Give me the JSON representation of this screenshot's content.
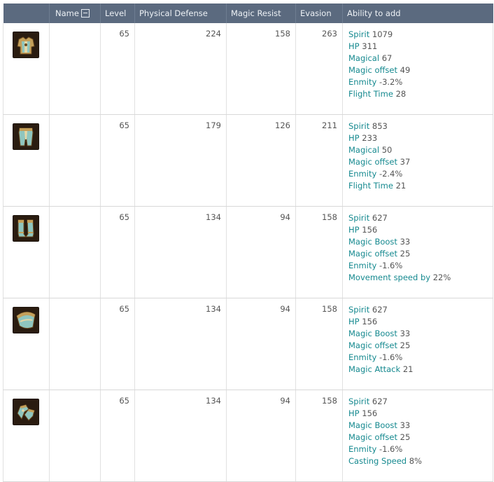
{
  "header": {
    "name": "Name",
    "level": "Level",
    "physical_defense": "Physical Defense",
    "magic_resist": "Magic Resist",
    "evasion": "Evasion",
    "ability": "Ability to add"
  },
  "colors": {
    "header_bg": "#5b6a7f",
    "ability_label": "#15898f",
    "gold_trim": "#c4a05a",
    "cloth_teal": "#8fc6bf"
  },
  "rows": [
    {
      "icon": "chest-armor-icon",
      "level": "65",
      "physical_defense": "224",
      "magic_resist": "158",
      "evasion": "263",
      "abilities": [
        {
          "label": "Spirit",
          "value": "1079"
        },
        {
          "label": "HP",
          "value": "311"
        },
        {
          "label": "Magical",
          "value": "67"
        },
        {
          "label": "Magic offset",
          "value": "49"
        },
        {
          "label": "Enmity",
          "value": "-3.2%"
        },
        {
          "label": "Flight Time",
          "value": "28"
        }
      ]
    },
    {
      "icon": "leg-armor-icon",
      "level": "65",
      "physical_defense": "179",
      "magic_resist": "126",
      "evasion": "211",
      "abilities": [
        {
          "label": "Spirit",
          "value": "853"
        },
        {
          "label": "HP",
          "value": "233"
        },
        {
          "label": "Magical",
          "value": "50"
        },
        {
          "label": "Magic offset",
          "value": "37"
        },
        {
          "label": "Enmity",
          "value": "-2.4%"
        },
        {
          "label": "Flight Time",
          "value": "21"
        }
      ]
    },
    {
      "icon": "boots-icon",
      "level": "65",
      "physical_defense": "134",
      "magic_resist": "94",
      "evasion": "158",
      "abilities": [
        {
          "label": "Spirit",
          "value": "627"
        },
        {
          "label": "HP",
          "value": "156"
        },
        {
          "label": "Magic Boost",
          "value": "33"
        },
        {
          "label": "Magic offset",
          "value": "25"
        },
        {
          "label": "Enmity",
          "value": "-1.6%"
        },
        {
          "label": "Movement speed by",
          "value": "22%"
        }
      ]
    },
    {
      "icon": "shoulder-armor-icon",
      "level": "65",
      "physical_defense": "134",
      "magic_resist": "94",
      "evasion": "158",
      "abilities": [
        {
          "label": "Spirit",
          "value": "627"
        },
        {
          "label": "HP",
          "value": "156"
        },
        {
          "label": "Magic Boost",
          "value": "33"
        },
        {
          "label": "Magic offset",
          "value": "25"
        },
        {
          "label": "Enmity",
          "value": "-1.6%"
        },
        {
          "label": "Magic Attack",
          "value": "21"
        }
      ]
    },
    {
      "icon": "gloves-icon",
      "level": "65",
      "physical_defense": "134",
      "magic_resist": "94",
      "evasion": "158",
      "abilities": [
        {
          "label": "Spirit",
          "value": "627"
        },
        {
          "label": "HP",
          "value": "156"
        },
        {
          "label": "Magic Boost",
          "value": "33"
        },
        {
          "label": "Magic offset",
          "value": "25"
        },
        {
          "label": "Enmity",
          "value": "-1.6%"
        },
        {
          "label": "Casting Speed",
          "value": "8%"
        }
      ]
    }
  ]
}
